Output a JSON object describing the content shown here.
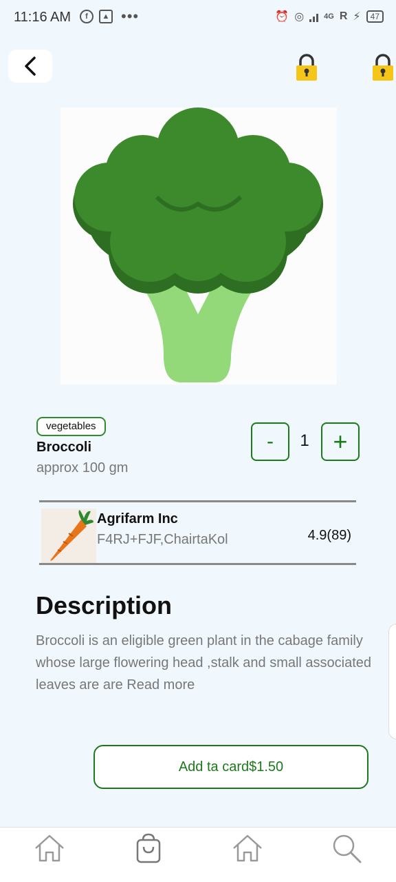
{
  "status_bar": {
    "time": "11:16 AM",
    "network_label": "4G",
    "carrier_mark": "R",
    "battery": "47"
  },
  "header": {
    "back_icon": "chevron-left-icon",
    "lock_icons": [
      "lock-icon",
      "lock-icon"
    ],
    "lock_color": "#f5c518"
  },
  "product": {
    "category": "vegetables",
    "name": "Broccoli",
    "weight": "approx 100 gm",
    "quantity": "1",
    "minus_label": "-",
    "plus_label": "+"
  },
  "seller": {
    "name": "Agrifarm Inc",
    "location": "F4RJ+FJF,ChairtaKol",
    "rating": "4.9(89)"
  },
  "description": {
    "title": "Description",
    "text": "Broccoli is an eligible green plant in the cabage family whose large flowering head ,stalk and small associated leaves are are Read more"
  },
  "cart": {
    "button_label": "Add ta card$1.50"
  },
  "bottom_nav": {
    "items": [
      "home-icon",
      "shopping-bag-icon",
      "home-icon",
      "search-icon"
    ]
  },
  "colors": {
    "accent": "#1a7a1a",
    "background": "#f1f8fd",
    "muted_text": "#777777"
  }
}
